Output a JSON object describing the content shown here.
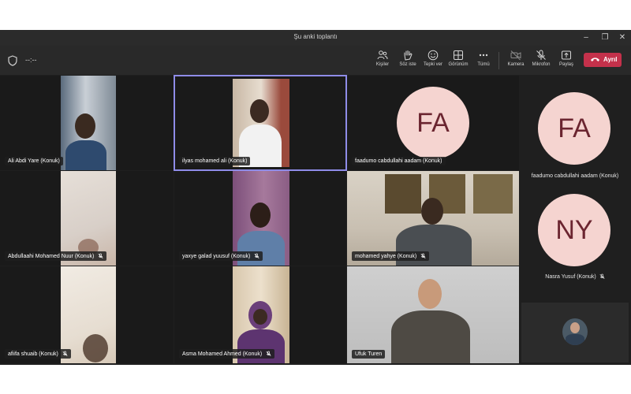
{
  "window": {
    "title": "Şu anki toplantı",
    "controls": [
      "–",
      "❐",
      "✕"
    ]
  },
  "toolbar": {
    "timer": "--:--",
    "items": [
      {
        "label": "Kişiler",
        "icon": "people-icon"
      },
      {
        "label": "Söz iste",
        "icon": "raise-hand-icon"
      },
      {
        "label": "Tepki ver",
        "icon": "smiley-icon"
      },
      {
        "label": "Görünüm",
        "icon": "grid-icon"
      },
      {
        "label": "Tümü",
        "icon": "more-icon"
      },
      {
        "label": "Kamera",
        "icon": "camera-off-icon"
      },
      {
        "label": "Mikrofon",
        "icon": "mic-off-icon"
      },
      {
        "label": "Paylaş",
        "icon": "share-icon"
      }
    ],
    "leave_label": "Ayrıl"
  },
  "participants": [
    {
      "name": "Ali Abdi Yare (Konuk)",
      "muted": false
    },
    {
      "name": "ilyas mohamed ali (Konuk)",
      "muted": false
    },
    {
      "name": "faadumo cabdullahi aadam (Konuk)",
      "muted": false,
      "initials": "FA"
    },
    {
      "name": "Abdullaahi Mohamed Nuur (Konuk)",
      "muted": true
    },
    {
      "name": "yaxye galad yuusuf (Konuk)",
      "muted": true
    },
    {
      "name": "mohamed yahye (Konuk)",
      "muted": true
    },
    {
      "name": "afiifa shuaib (Konuk)",
      "muted": true
    },
    {
      "name": "Asma Mohamed Ahmed (Konuk)",
      "muted": true
    },
    {
      "name": "Ufuk Turen",
      "muted": false
    }
  ],
  "side_panel": [
    {
      "initials": "FA",
      "name": "faadumo cabdullahi aadam (Konuk)",
      "muted": false
    },
    {
      "initials": "NY",
      "name": "Nasra Yusuf (Konuk)",
      "muted": true
    }
  ],
  "colors": {
    "accent": "#8f8ce8",
    "leave": "#c4314b",
    "avatar_bg": "#f5d4d0",
    "avatar_text": "#6b2530"
  }
}
